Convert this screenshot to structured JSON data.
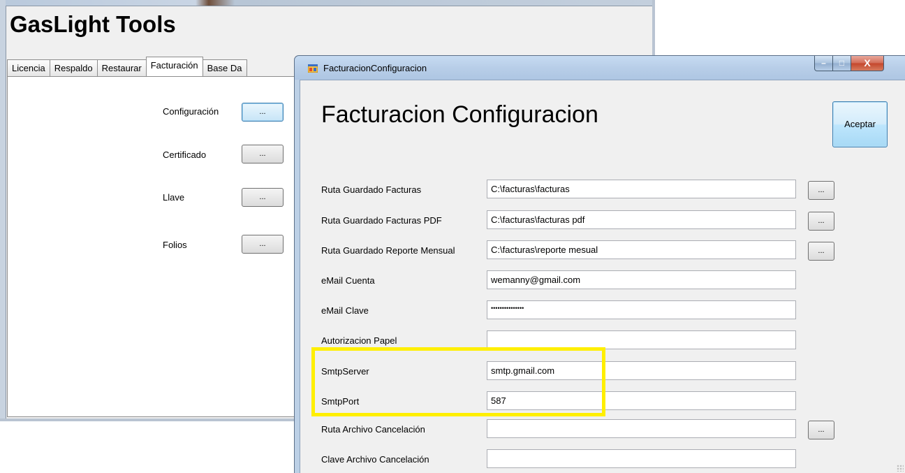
{
  "main_window": {
    "title": "GasLight Tools",
    "tabs": [
      {
        "label": "Licencia"
      },
      {
        "label": "Respaldo"
      },
      {
        "label": "Restaurar"
      },
      {
        "label": "Facturación"
      },
      {
        "label": "Base Da"
      }
    ],
    "active_tab": "Facturación",
    "panel": {
      "rows": [
        {
          "label": "Configuración",
          "button": "..."
        },
        {
          "label": "Certificado",
          "button": "..."
        },
        {
          "label": "Llave",
          "button": "..."
        },
        {
          "label": "Folios",
          "button": "..."
        }
      ]
    }
  },
  "dialog": {
    "window_title": "FacturacionConfiguracion",
    "heading": "Facturacion Configuracion",
    "accept_label": "Aceptar",
    "caption_buttons": {
      "minimize": "–",
      "maximize": "□",
      "close": "X"
    },
    "fields": [
      {
        "label": "Ruta Guardado Facturas",
        "value": "C:\\facturas\\facturas",
        "browse": "..."
      },
      {
        "label": "Ruta Guardado Facturas PDF",
        "value": "C:\\facturas\\facturas pdf",
        "browse": "..."
      },
      {
        "label": "Ruta Guardado Reporte Mensual",
        "value": "C:\\facturas\\reporte mesual",
        "browse": "..."
      },
      {
        "label": "eMail Cuenta",
        "value": "wemanny@gmail.com"
      },
      {
        "label": "eMail Clave",
        "value": "•••••••••••••••"
      },
      {
        "label": "Autorizacion Papel",
        "value": ""
      },
      {
        "label": "SmtpServer",
        "value": "smtp.gmail.com"
      },
      {
        "label": "SmtpPort",
        "value": "587"
      },
      {
        "label": "Ruta Archivo Cancelación",
        "value": "",
        "browse": "..."
      },
      {
        "label": "Clave Archivo Cancelación",
        "value": ""
      }
    ]
  },
  "colors": {
    "highlight": "#ffef00",
    "focus_border": "#3c7fb1",
    "window_frame": "#bcd0e6"
  }
}
